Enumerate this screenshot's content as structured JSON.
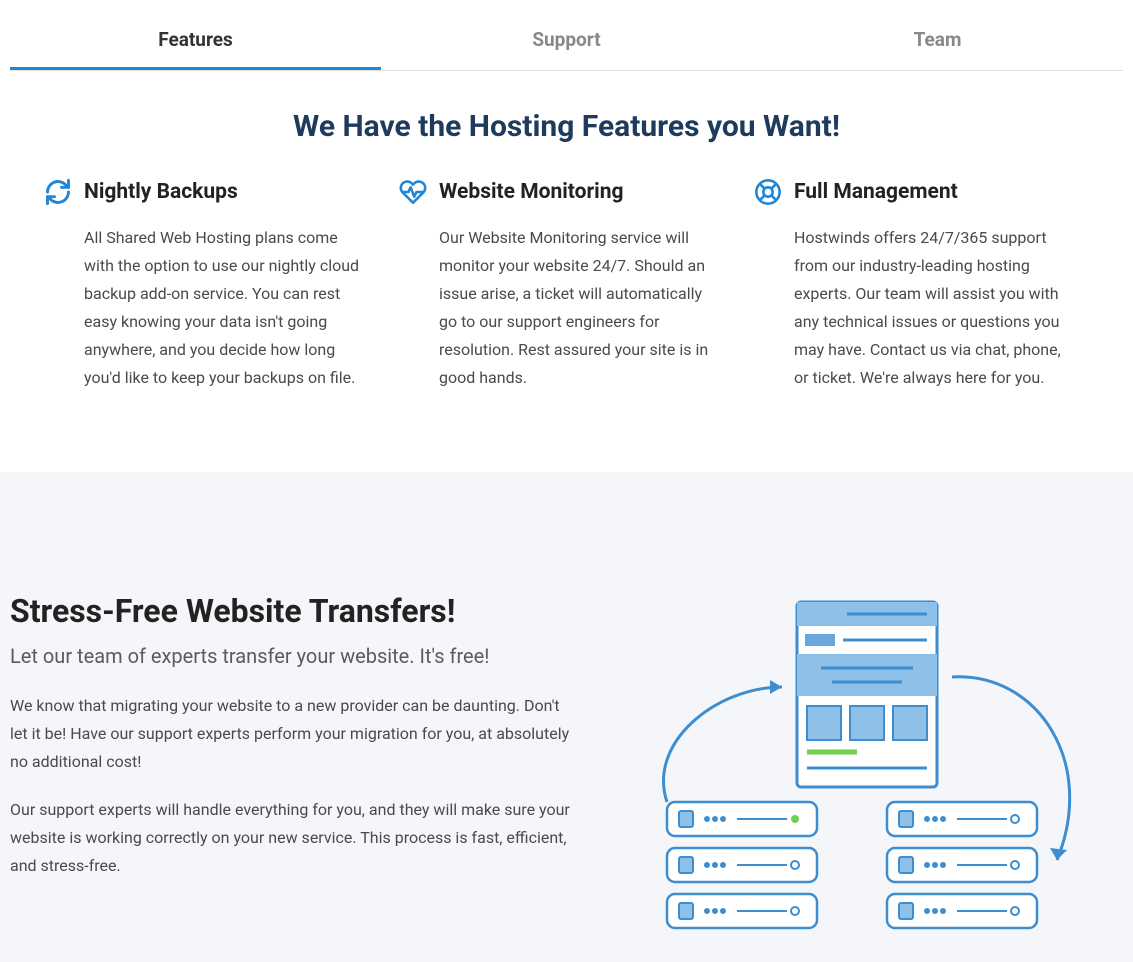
{
  "tabs": [
    {
      "label": "Features",
      "active": true
    },
    {
      "label": "Support",
      "active": false
    },
    {
      "label": "Team",
      "active": false
    }
  ],
  "headline": "We Have the Hosting Features you Want!",
  "features": [
    {
      "icon": "refresh-icon",
      "title": "Nightly Backups",
      "body": "All Shared Web Hosting plans come with the option to use our nightly cloud backup add-on service. You can rest easy knowing your data isn't going anywhere, and you decide how long you'd like to keep your backups on file."
    },
    {
      "icon": "heartbeat-icon",
      "title": "Website Monitoring",
      "body": "Our Website Monitoring service will monitor your website 24/7. Should an issue arise, a ticket will automatically go to our support engineers for resolution. Rest assured your site is in good hands."
    },
    {
      "icon": "lifebuoy-icon",
      "title": "Full Management",
      "body": "Hostwinds offers 24/7/365 support from our industry-leading hosting experts. Our team will assist you with any technical issues or questions you may have. Contact us via chat, phone, or ticket. We're always here for you."
    }
  ],
  "transfers": {
    "title": "Stress-Free Website Transfers!",
    "subtitle": "Let our team of experts transfer your website. It's free!",
    "p1": "We know that migrating your website to a new provider can be daunting. Don't let it be! Have our support experts perform your migration for you, at absolutely no additional cost!",
    "p2": "Our support experts will handle everything for you, and they will make sure your website is working correctly on your new service. This process is fast, efficient, and stress-free."
  },
  "colors": {
    "accent": "#1f87d6",
    "dark": "#1e3a5c",
    "panel": "#f5f6f9"
  }
}
